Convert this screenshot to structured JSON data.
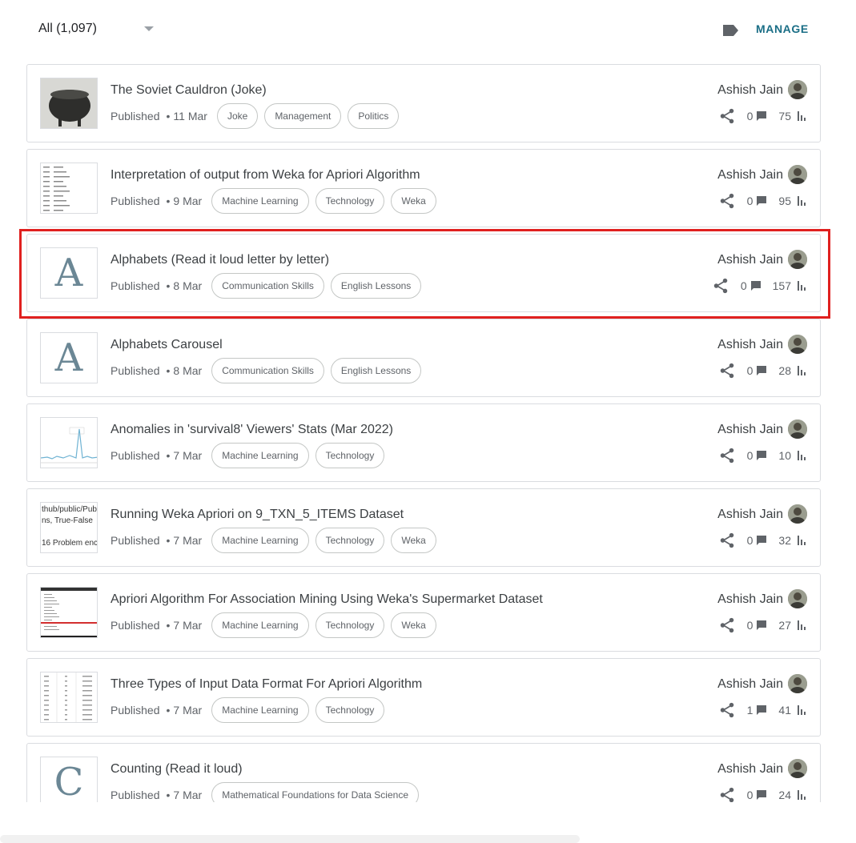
{
  "filter": {
    "label": "All (1,097)"
  },
  "header": {
    "manage_label": "MANAGE",
    "label_icon": "label-tag-icon"
  },
  "posts": [
    {
      "title": "The Soviet Cauldron (Joke)",
      "status": "Published",
      "date": "11 Mar",
      "labels": [
        "Joke",
        "Management",
        "Politics"
      ],
      "author": "Ashish Jain",
      "comments": "0",
      "views": "75",
      "thumb": {
        "type": "image",
        "icon": "cauldron-thumbnail"
      }
    },
    {
      "title": "Interpretation of output from Weka for Apriori Algorithm",
      "status": "Published",
      "date": "9 Mar",
      "labels": [
        "Machine Learning",
        "Technology",
        "Weka"
      ],
      "author": "Ashish Jain",
      "comments": "0",
      "views": "95",
      "thumb": {
        "type": "image",
        "icon": "transaction-table-thumbnail"
      }
    },
    {
      "title": "Alphabets (Read it loud letter by letter)",
      "status": "Published",
      "date": "8 Mar",
      "labels": [
        "Communication Skills",
        "English Lessons"
      ],
      "author": "Ashish Jain",
      "comments": "0",
      "views": "157",
      "thumb": {
        "type": "letter",
        "letter": "A"
      }
    },
    {
      "title": "Alphabets Carousel",
      "status": "Published",
      "date": "8 Mar",
      "labels": [
        "Communication Skills",
        "English Lessons"
      ],
      "author": "Ashish Jain",
      "comments": "0",
      "views": "28",
      "thumb": {
        "type": "letter",
        "letter": "A"
      }
    },
    {
      "title": "Anomalies in 'survival8' Viewers' Stats (Mar 2022)",
      "status": "Published",
      "date": "7 Mar",
      "labels": [
        "Machine Learning",
        "Technology"
      ],
      "author": "Ashish Jain",
      "comments": "0",
      "views": "10",
      "thumb": {
        "type": "image",
        "icon": "stats-graph-thumbnail"
      }
    },
    {
      "title": "Running Weka Apriori on 9_TXN_5_ITEMS Dataset",
      "status": "Published",
      "date": "7 Mar",
      "labels": [
        "Machine Learning",
        "Technology",
        "Weka"
      ],
      "author": "Ashish Jain",
      "comments": "0",
      "views": "32",
      "thumb": {
        "type": "text",
        "lines": [
          "thub/public/Pub",
          "ns, True-False",
          "",
          "16 Problem enc"
        ]
      }
    },
    {
      "title": "Apriori Algorithm For Association Mining Using Weka's Supermarket Dataset",
      "status": "Published",
      "date": "7 Mar",
      "labels": [
        "Machine Learning",
        "Technology",
        "Weka"
      ],
      "author": "Ashish Jain",
      "comments": "0",
      "views": "27",
      "thumb": {
        "type": "image",
        "icon": "weka-screenshot-thumbnail"
      }
    },
    {
      "title": "Three Types of Input Data Format For Apriori Algorithm",
      "status": "Published",
      "date": "7 Mar",
      "labels": [
        "Machine Learning",
        "Technology"
      ],
      "author": "Ashish Jain",
      "comments": "1",
      "views": "41",
      "thumb": {
        "type": "image",
        "icon": "data-table-thumbnail"
      }
    },
    {
      "title": "Counting (Read it loud)",
      "status": "Published",
      "date": "7 Mar",
      "labels": [
        "Mathematical Foundations for Data Science"
      ],
      "author": "Ashish Jain",
      "comments": "0",
      "views": "24",
      "thumb": {
        "type": "letter",
        "letter": "C"
      }
    }
  ],
  "colors": {
    "accent": "#1a6e86",
    "highlight": "#e0201f",
    "border": "#dadce0"
  }
}
